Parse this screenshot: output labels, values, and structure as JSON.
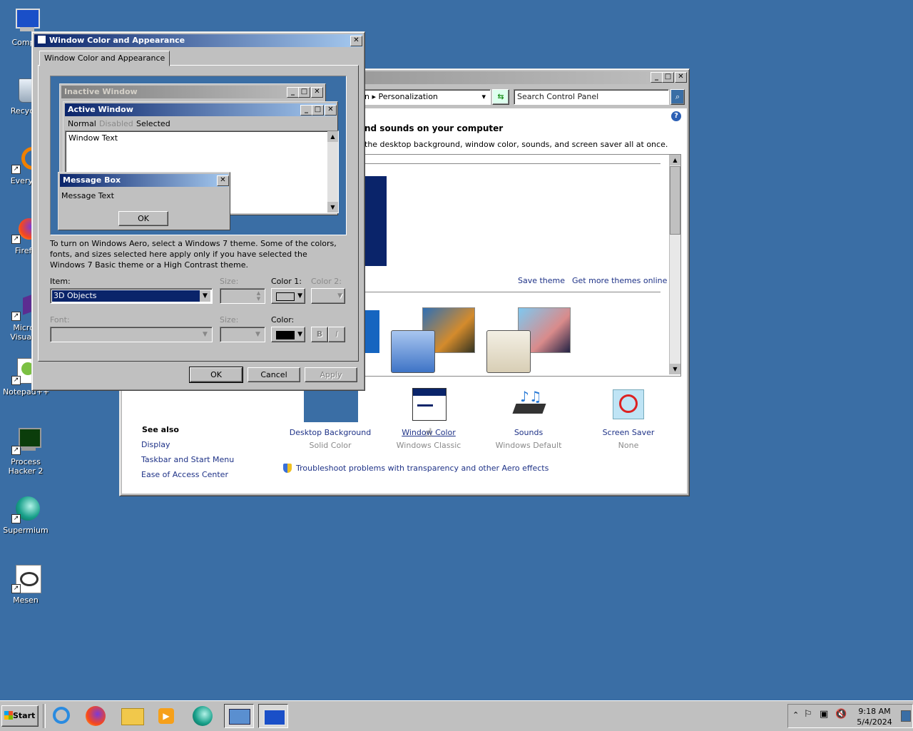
{
  "desktop": {
    "icons": [
      {
        "label": "Compu",
        "icon": "computer-icon"
      },
      {
        "label": "Recycle",
        "icon": "recycle-bin-icon"
      },
      {
        "label": "Everyth",
        "icon": "everything-icon"
      },
      {
        "label": "Firefo",
        "icon": "firefox-icon"
      },
      {
        "label": "Micros\nVisual S",
        "icon": "visual-studio-icon"
      },
      {
        "label": "Notepad++",
        "icon": "notepadpp-icon"
      },
      {
        "label": "Process\nHacker 2",
        "icon": "process-hacker-icon"
      },
      {
        "label": "Supermium",
        "icon": "supermium-icon"
      },
      {
        "label": "Mesen",
        "icon": "mesen-icon"
      }
    ]
  },
  "control_panel": {
    "breadcrumb_sep": "n ▸",
    "breadcrumb": "Personalization",
    "search_placeholder": "Search Control Panel",
    "heading": "nd sounds on your computer",
    "subheading": "the desktop background, window color, sounds, and screen saver all at once.",
    "save_theme": "Save theme",
    "get_more_themes": "Get more themes online",
    "see_also": "See also",
    "see_also_links": [
      "Display",
      "Taskbar and Start Menu",
      "Ease of Access Center"
    ],
    "items": [
      {
        "label": "Desktop Background",
        "sub": "Solid Color"
      },
      {
        "label": "Window Color",
        "sub": "Windows Classic"
      },
      {
        "label": "Sounds",
        "sub": "Windows Default"
      },
      {
        "label": "Screen Saver",
        "sub": "None"
      }
    ],
    "troubleshoot": "Troubleshoot problems with transparency and other Aero effects",
    "help": "?"
  },
  "dialog": {
    "title": "Window Color and Appearance",
    "tab": "Window Color and Appearance",
    "preview": {
      "inactive_title": "Inactive Window",
      "active_title": "Active Window",
      "menu": [
        "Normal",
        "Disabled",
        "Selected"
      ],
      "window_text": "Window Text",
      "msgbox_title": "Message Box",
      "msgbox_text": "Message Text",
      "msgbox_ok": "OK"
    },
    "info": "To turn on Windows Aero, select a Windows 7 theme.  Some of the colors, fonts, and sizes selected here apply only if you have selected the Windows 7 Basic theme or a High Contrast theme.",
    "item_label": "Item:",
    "item_value": "3D Objects",
    "size_label": "Size:",
    "color1_label": "Color 1:",
    "color2_label": "Color 2:",
    "font_label": "Font:",
    "font_size_label": "Size:",
    "color_label": "Color:",
    "bold": "B",
    "italic": "I",
    "ok": "OK",
    "cancel": "Cancel",
    "apply": "Apply"
  },
  "taskbar": {
    "start": "Start",
    "time": "9:18 AM",
    "date": "5/4/2024"
  },
  "colors": {
    "desktop": "#3a6ea5",
    "selection": "#0a246a",
    "link": "#1e3287"
  }
}
